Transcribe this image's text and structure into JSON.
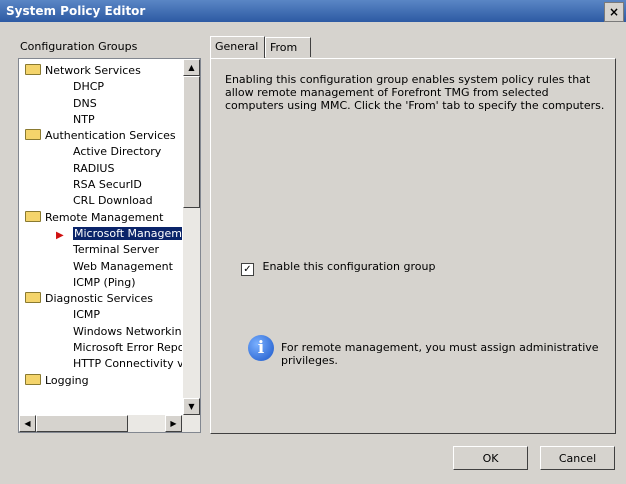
{
  "window": {
    "title": "System Policy Editor",
    "close_glyph": "×"
  },
  "groups_label": "Configuration Groups",
  "tree": [
    {
      "label": "Network Services",
      "level": 0,
      "folder": true
    },
    {
      "label": "DHCP",
      "level": 1
    },
    {
      "label": "DNS",
      "level": 1
    },
    {
      "label": "NTP",
      "level": 1
    },
    {
      "label": "Authentication Services",
      "level": 0,
      "folder": true
    },
    {
      "label": "Active Directory",
      "level": 1
    },
    {
      "label": "RADIUS",
      "level": 1
    },
    {
      "label": "RSA SecurID",
      "level": 1
    },
    {
      "label": "CRL Download",
      "level": 1
    },
    {
      "label": "Remote Management",
      "level": 0,
      "folder": true
    },
    {
      "label": "Microsoft Manageme",
      "level": 1,
      "selected": true
    },
    {
      "label": "Terminal Server",
      "level": 1
    },
    {
      "label": "Web Management",
      "level": 1
    },
    {
      "label": "ICMP (Ping)",
      "level": 1
    },
    {
      "label": "Diagnostic Services",
      "level": 0,
      "folder": true
    },
    {
      "label": "ICMP",
      "level": 1
    },
    {
      "label": "Windows Networking",
      "level": 1
    },
    {
      "label": "Microsoft Error Repo",
      "level": 1
    },
    {
      "label": "HTTP Connectivity ve",
      "level": 1
    },
    {
      "label": "Logging",
      "level": 0,
      "folder": true
    }
  ],
  "tabs": {
    "general": "General",
    "from": "From"
  },
  "description": "Enabling this configuration group enables system policy rules that allow remote management of Forefront TMG from selected computers using MMC. Click the 'From' tab to specify the computers.",
  "checkbox": {
    "label": "Enable this configuration group",
    "checked": true,
    "mark": "✓"
  },
  "info": {
    "glyph": "i",
    "text": "For remote management, you must assign administrative privileges."
  },
  "buttons": {
    "ok": "OK",
    "cancel": "Cancel"
  },
  "scroll_glyphs": {
    "up": "▲",
    "down": "▼",
    "left": "◀",
    "right": "▶"
  }
}
